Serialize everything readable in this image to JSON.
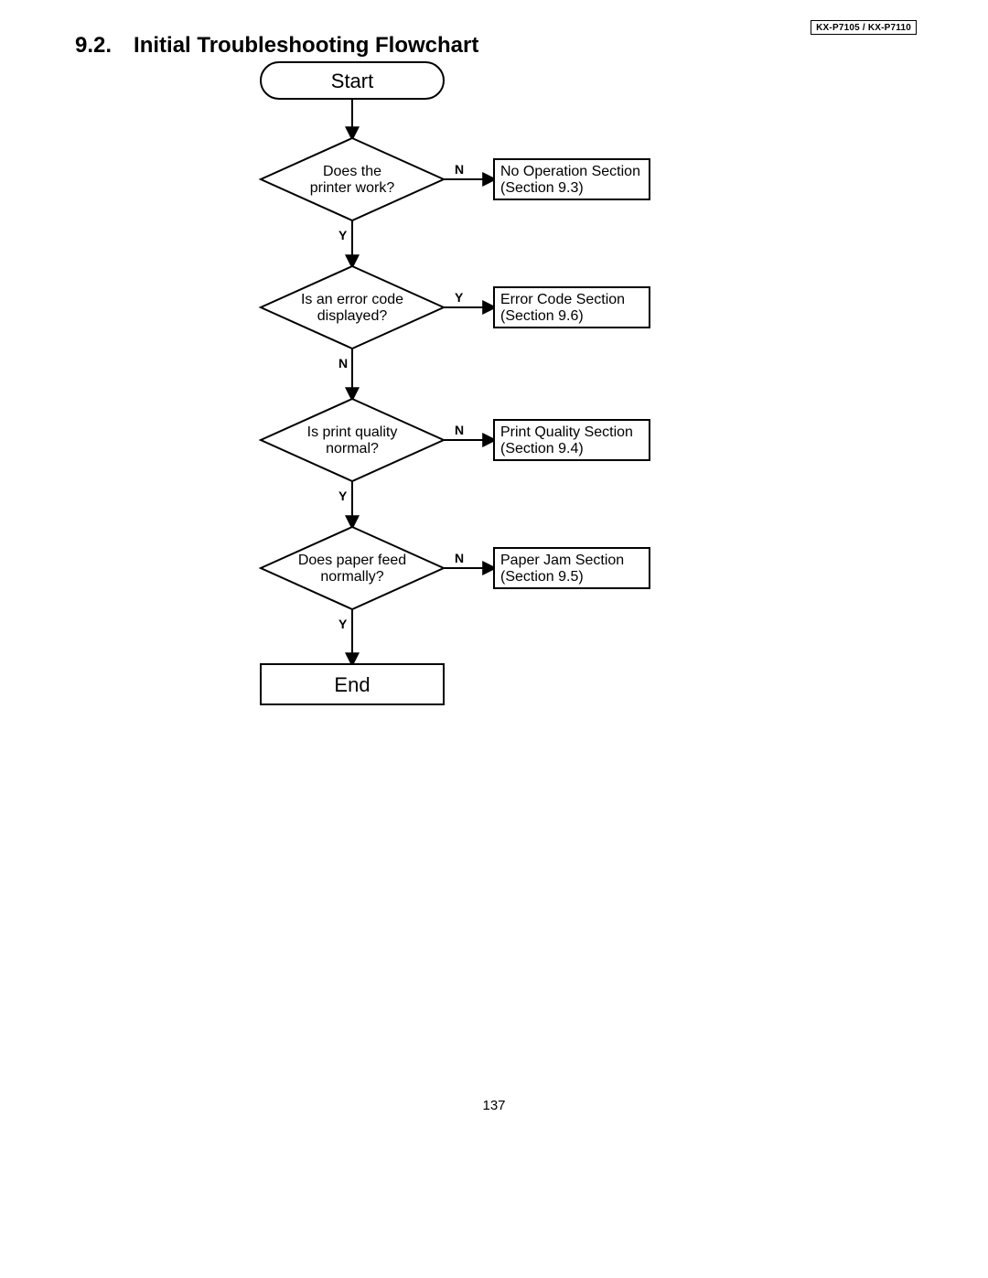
{
  "header": {
    "model_badge": "KX-P7105  / KX-P7110",
    "section_number": "9.2.",
    "section_title": "Initial Troubleshooting Flowchart"
  },
  "flow": {
    "start": "Start",
    "end": "End",
    "d1": {
      "line1": "Does the",
      "line2": "printer work?"
    },
    "d2": {
      "line1": "Is an error code",
      "line2": "displayed?"
    },
    "d3": {
      "line1": "Is print quality",
      "line2": "normal?"
    },
    "d4": {
      "line1": "Does paper feed",
      "line2": "normally?"
    },
    "r1": {
      "line1": "No Operation Section",
      "line2": "(Section 9.3)"
    },
    "r2": {
      "line1": "Error Code Section",
      "line2": "(Section 9.6)"
    },
    "r3": {
      "line1": "Print Quality Section",
      "line2": "(Section 9.4)"
    },
    "r4": {
      "line1": "Paper Jam Section",
      "line2": "(Section 9.5)"
    },
    "labels": {
      "yes": "Y",
      "no": "N"
    }
  },
  "footer": {
    "page_number": "137"
  }
}
